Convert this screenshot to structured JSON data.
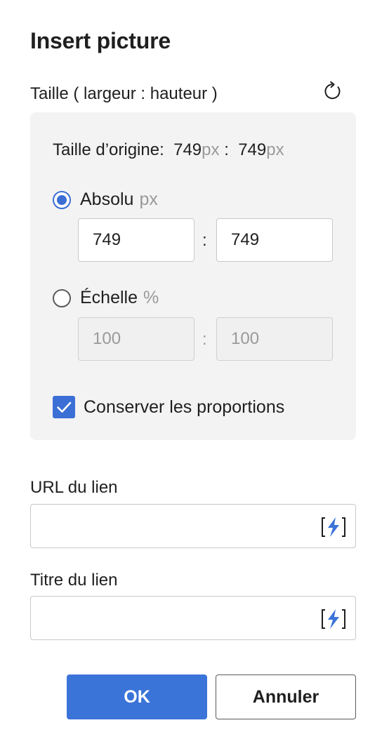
{
  "dialog": {
    "title": "Insert picture",
    "size_label": "Taille ( largeur : hauteur )",
    "original": {
      "label": "Taille d’origine:",
      "width": "749",
      "height": "749",
      "unit": "px",
      "separator": ":"
    },
    "absolute": {
      "label": "Absolu",
      "unit": "px",
      "selected": true,
      "width_value": "749",
      "height_value": "749",
      "separator": ":"
    },
    "scale": {
      "label": "Échelle",
      "unit": "%",
      "selected": false,
      "width_value": "100",
      "height_value": "100",
      "separator": ":"
    },
    "keep_ratio": {
      "label": "Conserver les proportions",
      "checked": true
    },
    "link_url": {
      "label": "URL du lien",
      "value": ""
    },
    "link_title": {
      "label": "Titre du lien",
      "value": ""
    },
    "buttons": {
      "ok": "OK",
      "cancel": "Annuler"
    },
    "colors": {
      "accent": "#3b74d8",
      "panel_bg": "#f3f3f3",
      "muted_text": "#9a9a9a"
    },
    "icons": {
      "reset": "refresh-icon",
      "dynamic_content": "lightning-bracket-icon"
    }
  }
}
